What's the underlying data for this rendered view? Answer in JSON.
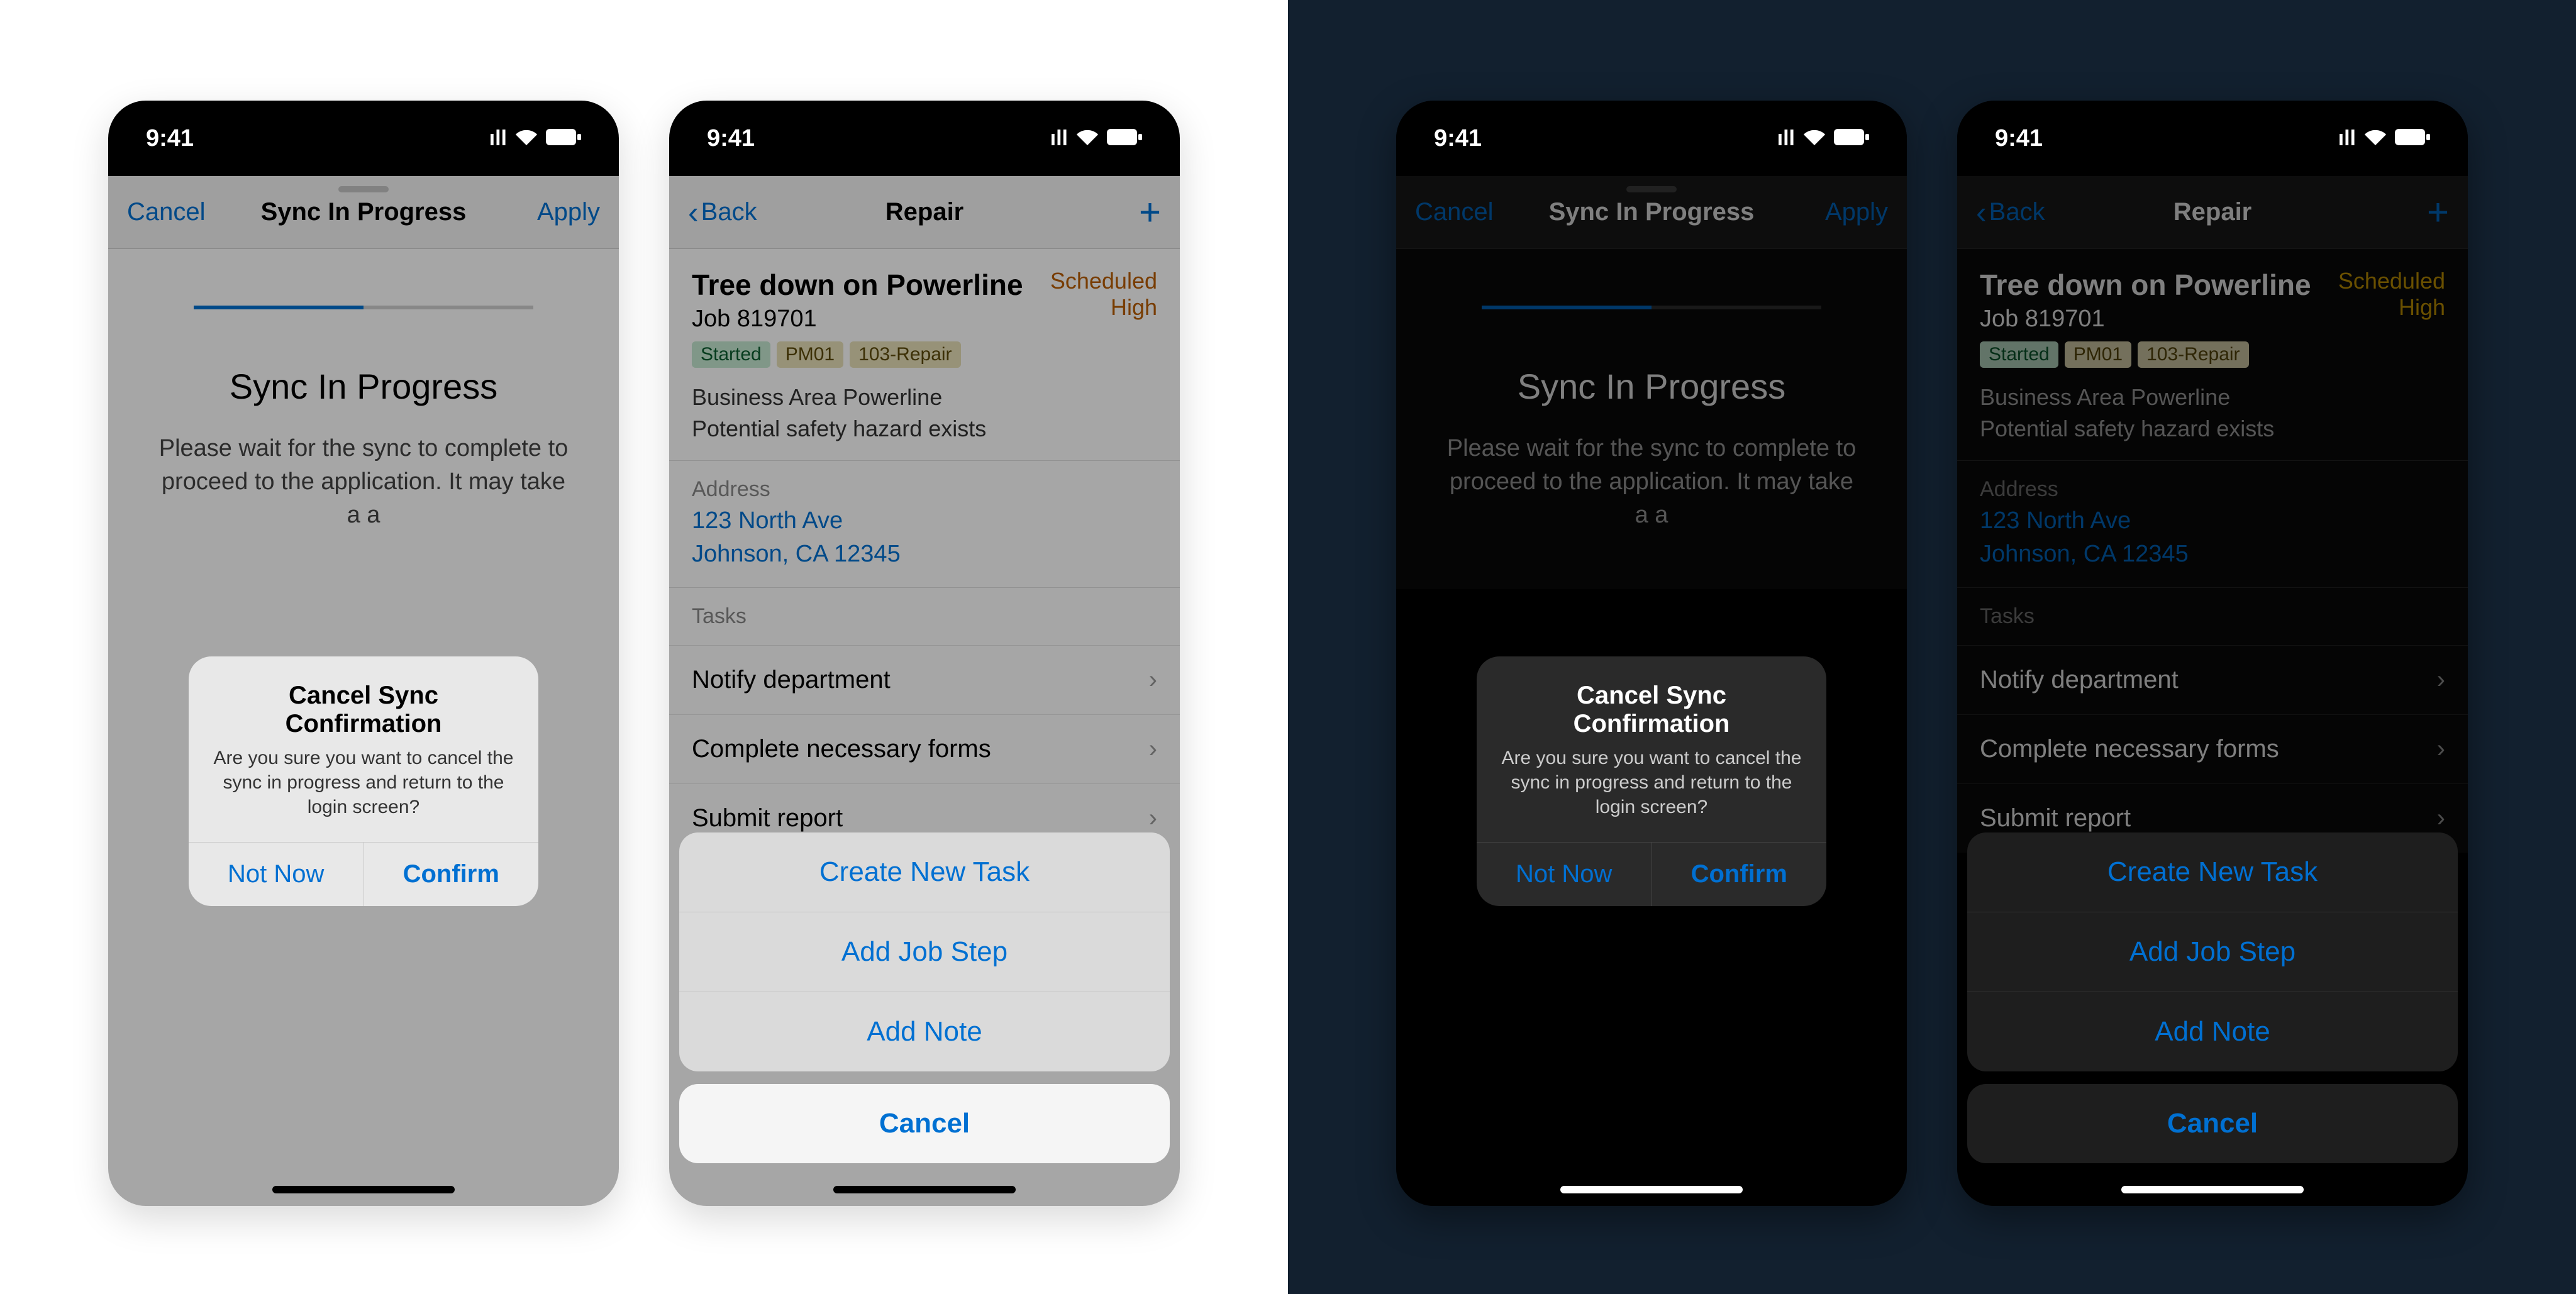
{
  "status": {
    "time": "9:41",
    "signal": "••••",
    "wifi": "⬡",
    "battery": "▬"
  },
  "sync": {
    "nav_cancel": "Cancel",
    "nav_title": "Sync In Progress",
    "nav_apply": "Apply",
    "title": "Sync In Progress",
    "description": "Please wait for the sync to complete to proceed to the application. It may take a  a",
    "alert_title": "Cancel Sync Confirmation",
    "alert_message": "Are you sure you want to cancel the sync in progress and return to the login screen?",
    "alert_not_now": "Not Now",
    "alert_confirm": "Confirm"
  },
  "repair": {
    "nav_back": "Back",
    "nav_title": "Repair",
    "title": "Tree down on Powerline",
    "job": "Job 819701",
    "status_scheduled": "Scheduled",
    "status_high": "High",
    "badge_started": "Started",
    "badge_pm01": "PM01",
    "badge_103": "103-Repair",
    "meta_line1": "Business Area Powerline",
    "meta_line2": "Potential safety hazard exists",
    "address_label": "Address",
    "address_line1": "123 North Ave",
    "address_line2": "Johnson, CA 12345",
    "tasks_label": "Tasks",
    "task1": "Notify department",
    "task2": "Complete necessary forms",
    "task3": "Submit report",
    "action1": "Create New Task",
    "action2": "Add Job Step",
    "action3": "Add Note",
    "action_cancel": "Cancel"
  }
}
